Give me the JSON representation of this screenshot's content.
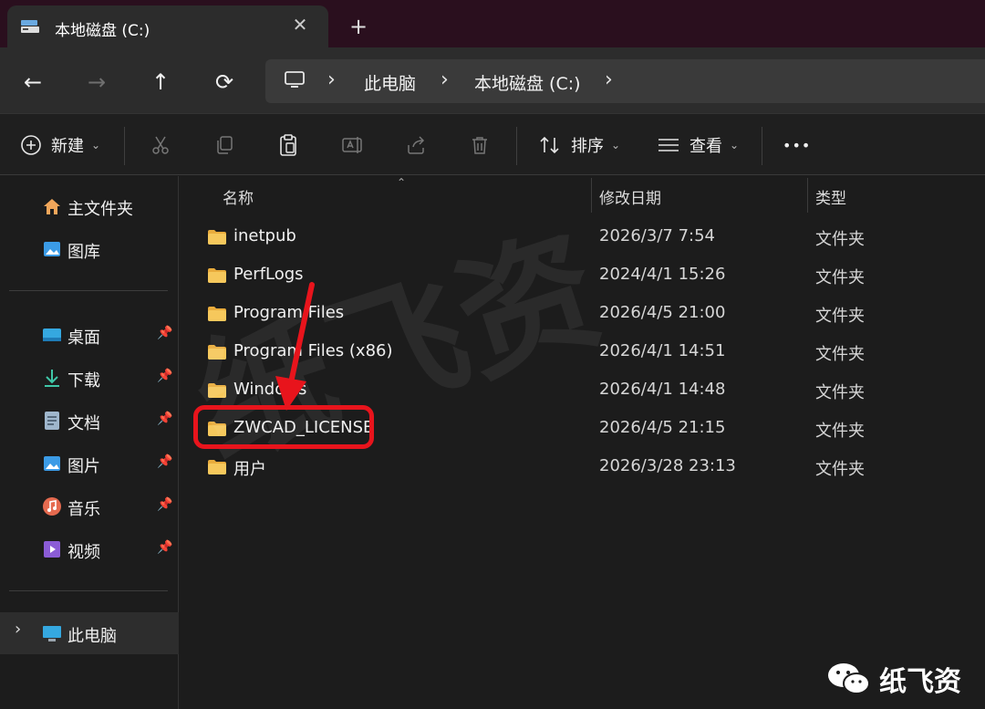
{
  "tab": {
    "title": "本地磁盘 (C:)",
    "close": "✕",
    "new": "+"
  },
  "nav": {
    "back": "←",
    "forward": "→",
    "up": "↑",
    "refresh": "⟳"
  },
  "address": {
    "sep1": "›",
    "crumb1": "此电脑",
    "sep2": "›",
    "crumb2": "本地磁盘 (C:)",
    "sep3": "›"
  },
  "toolbar": {
    "new_label": "新建",
    "sort_label": "排序",
    "view_label": "查看",
    "more_label": "•••"
  },
  "sidebar": {
    "items": [
      {
        "label": "主文件夹",
        "icon": "home-icon"
      },
      {
        "label": "图库",
        "icon": "gallery-icon"
      },
      {
        "label": "桌面",
        "icon": "desktop-icon",
        "pinned": true
      },
      {
        "label": "下载",
        "icon": "download-icon",
        "pinned": true
      },
      {
        "label": "文档",
        "icon": "document-icon",
        "pinned": true
      },
      {
        "label": "图片",
        "icon": "pictures-icon",
        "pinned": true
      },
      {
        "label": "音乐",
        "icon": "music-icon",
        "pinned": true
      },
      {
        "label": "视频",
        "icon": "video-icon",
        "pinned": true
      },
      {
        "label": "此电脑",
        "icon": "computer-icon",
        "selected": true
      }
    ],
    "pin": "📌",
    "expand": "›"
  },
  "columns": {
    "name": "名称",
    "modified": "修改日期",
    "type": "类型",
    "sort_indicator": "⌃"
  },
  "files": [
    {
      "name": "inetpub",
      "date": "2026/3/7 7:54",
      "type": "文件夹"
    },
    {
      "name": "PerfLogs",
      "date": "2024/4/1 15:26",
      "type": "文件夹"
    },
    {
      "name": "Program Files",
      "date": "2026/4/5 21:00",
      "type": "文件夹"
    },
    {
      "name": "Program Files (x86)",
      "date": "2026/4/1 14:51",
      "type": "文件夹"
    },
    {
      "name": "Windows",
      "date": "2026/4/1 14:48",
      "type": "文件夹"
    },
    {
      "name": "ZWCAD_LICENSE",
      "date": "2026/4/5 21:15",
      "type": "文件夹"
    },
    {
      "name": "用户",
      "date": "2026/3/28 23:13",
      "type": "文件夹"
    }
  ],
  "watermark": "纸飞资",
  "brand": {
    "text": "纸飞资"
  },
  "colors": {
    "accent": "#e8141c",
    "folder": "#f4c24f",
    "tabbar": "#2a0f1e"
  }
}
